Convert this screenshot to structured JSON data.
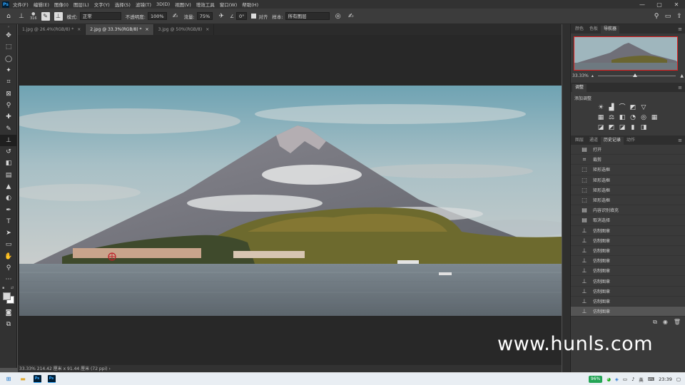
{
  "app": {
    "logo": "Ps"
  },
  "menubar": {
    "items": [
      "文件(F)",
      "编辑(E)",
      "图像(I)",
      "图层(L)",
      "文字(Y)",
      "选择(S)",
      "滤镜(T)",
      "3D(D)",
      "视图(V)",
      "增效工具",
      "窗口(W)",
      "帮助(H)"
    ],
    "window_controls": [
      "—",
      "▢",
      "✕"
    ]
  },
  "options": {
    "brush_size": "316",
    "mode_label": "模式:",
    "mode_value": "正常",
    "opacity_label": "不透明度:",
    "opacity_value": "100%",
    "flow_label": "流量:",
    "flow_value": "75%",
    "angle_value": "0°",
    "align_label": "对齐",
    "sample_label": "样本:",
    "sample_value": "所有图层"
  },
  "tabs": [
    {
      "label": "1.jpg @ 26.4%(RGB/8) *",
      "active": false
    },
    {
      "label": "2.jpg @ 33.3%(RGB/8) *",
      "active": true
    },
    {
      "label": "3.jpg @ 50%(RGB/8)",
      "active": false
    }
  ],
  "status": {
    "text": "33.33%   214.42 厘米 x 91.44 厘米 (72 ppi)   ›"
  },
  "panels": {
    "nav_tabs": [
      "颜色",
      "色板",
      "导航器"
    ],
    "nav_zoom": "33.33%",
    "adj_tabs": [
      "调整"
    ],
    "adj_add": "添加调整",
    "hist_tabs": [
      "图层",
      "通道",
      "历史记录",
      "动作"
    ],
    "history": [
      {
        "icon": "doc",
        "label": "打开"
      },
      {
        "icon": "crop",
        "label": "裁剪"
      },
      {
        "icon": "marquee",
        "label": "矩形选框"
      },
      {
        "icon": "marquee",
        "label": "矩形选框"
      },
      {
        "icon": "marquee",
        "label": "矩形选框"
      },
      {
        "icon": "marquee",
        "label": "矩形选框"
      },
      {
        "icon": "doc",
        "label": "内容识别填充"
      },
      {
        "icon": "doc",
        "label": "取消选择"
      },
      {
        "icon": "stamp",
        "label": "仿制图章"
      },
      {
        "icon": "stamp",
        "label": "仿制图章"
      },
      {
        "icon": "stamp",
        "label": "仿制图章"
      },
      {
        "icon": "stamp",
        "label": "仿制图章"
      },
      {
        "icon": "stamp",
        "label": "仿制图章"
      },
      {
        "icon": "stamp",
        "label": "仿制图章"
      },
      {
        "icon": "stamp",
        "label": "仿制图章"
      },
      {
        "icon": "stamp",
        "label": "仿制图章"
      },
      {
        "icon": "stamp",
        "label": "仿制图章"
      }
    ]
  },
  "taskbar": {
    "battery": "96%",
    "ime": "英",
    "time": "23:39"
  },
  "watermark": "www.hunls.com"
}
